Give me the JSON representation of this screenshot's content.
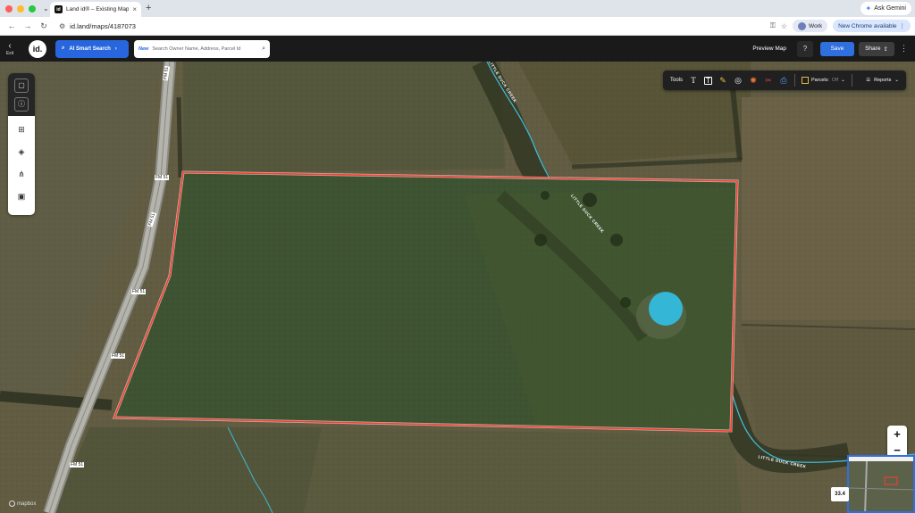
{
  "browser": {
    "tab_title": "Land id® – Existing Map Edit",
    "favicon_text": "id",
    "url": "id.land/maps/4187073",
    "gemini_label": "Ask Gemini",
    "profile_label": "Work",
    "update_label": "New Chrome available"
  },
  "header": {
    "exit_label": "Exit",
    "logo_text": "id.",
    "ai_search_label": "AI Smart Search",
    "search_new_badge": "New",
    "search_placeholder": "Search Owner Name, Address, Parcel Id",
    "preview_label": "Preview Map",
    "help_label": "?",
    "save_label": "Save",
    "share_label": "Share"
  },
  "left_panel": {
    "icons": [
      "parcel-icon",
      "info-icon",
      "map-icon",
      "layers-icon",
      "hierarchy-icon",
      "image-icon"
    ]
  },
  "tools_bar": {
    "tools_label": "Tools",
    "parcels_label": "Parcels:",
    "parcels_state": "Off",
    "reports_label": "Reports"
  },
  "map": {
    "road_labels": [
      "FM 51",
      "FM 51",
      "FM 51",
      "FM 51",
      "FM 51",
      "FM 51"
    ],
    "creek_labels": [
      "LITTLE DUCK CREEK",
      "LITTLE DUCK CREEK",
      "LITTLE DUCK CREEK"
    ],
    "boundary_color": "#ff3b30",
    "water_color": "#34b6d6",
    "zoom_in": "+",
    "zoom_out": "−",
    "acreage_label": "33.4",
    "attribution": "mapbox"
  }
}
